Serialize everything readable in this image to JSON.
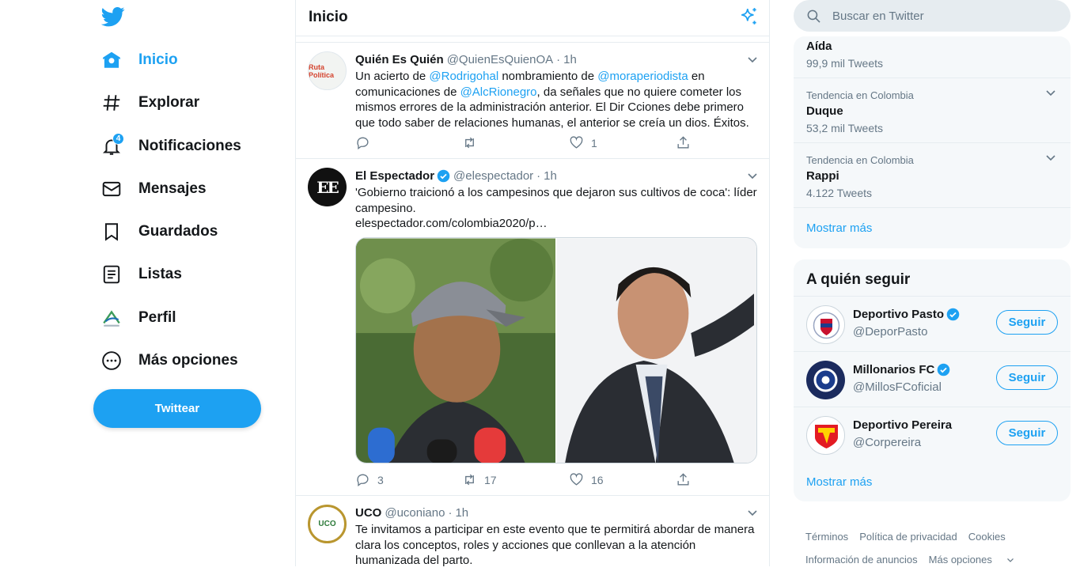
{
  "nav": {
    "items": [
      {
        "label": "Inicio",
        "icon": "home-icon"
      },
      {
        "label": "Explorar",
        "icon": "hashtag-icon"
      },
      {
        "label": "Notificaciones",
        "icon": "bell-icon",
        "badge": "4"
      },
      {
        "label": "Mensajes",
        "icon": "envelope-icon"
      },
      {
        "label": "Guardados",
        "icon": "bookmark-icon"
      },
      {
        "label": "Listas",
        "icon": "list-icon"
      },
      {
        "label": "Perfil",
        "icon": "profile-avatar-icon"
      },
      {
        "label": "Más opciones",
        "icon": "more-circle-icon"
      }
    ],
    "tweet_button": "Twittear"
  },
  "main": {
    "title": "Inicio",
    "tweets": [
      {
        "name": "Quién Es Quién",
        "handle": "@QuienEsQuienOA",
        "sep": "·",
        "time": "1h",
        "text_parts": {
          "p1": "Un acierto de ",
          "m1": "@Rodrigohal",
          "p2": " nombramiento de ",
          "m2": "@moraperiodista",
          "p3": " en comunicaciones de ",
          "m3": "@AlcRionegro",
          "p4": ", da señales que no quiere cometer los mismos errores de la administración anterior. El Dir Cciones debe primero que todo saber de relaciones humanas, el anterior se creía un dios. Éxitos."
        },
        "replies": "",
        "retweets": "",
        "likes": "1",
        "avatar_text": "Ruta Política"
      },
      {
        "name": "El Espectador",
        "handle": "@elespectador",
        "sep": "·",
        "time": "1h",
        "text": "'Gobierno traicionó a los campesinos que dejaron sus cultivos de coca': líder campesino.",
        "link": "elespectador.com/colombia2020/p…",
        "replies": "3",
        "retweets": "17",
        "likes": "16",
        "avatar_text": "EE"
      },
      {
        "name": "UCO",
        "handle": "@uconiano",
        "sep": "·",
        "time": "1h",
        "text": "Te invitamos a participar en este evento que te permitirá abordar de manera clara los conceptos, roles y acciones que conllevan a la atención humanizada del parto.",
        "avatar_text": "UCO"
      }
    ]
  },
  "search": {
    "placeholder": "Buscar en Twitter"
  },
  "trends": {
    "items": [
      {
        "context": "",
        "name": "Aída",
        "count": "99,9 mil Tweets"
      },
      {
        "context": "Tendencia en Colombia",
        "name": "Duque",
        "count": "53,2 mil Tweets"
      },
      {
        "context": "Tendencia en Colombia",
        "name": "Rappi",
        "count": "4.122 Tweets"
      }
    ],
    "show_more": "Mostrar más"
  },
  "who_to_follow": {
    "title": "A quién seguir",
    "accounts": [
      {
        "name": "Deportivo Pasto",
        "handle": "@DeporPasto",
        "button": "Seguir"
      },
      {
        "name": "Millonarios FC",
        "handle": "@MillosFCoficial",
        "button": "Seguir"
      },
      {
        "name": "Deportivo Pereira",
        "handle": "@Corpereira",
        "button": "Seguir"
      }
    ],
    "show_more": "Mostrar más"
  },
  "footer": {
    "links": [
      "Términos",
      "Política de privacidad",
      "Cookies",
      "Información de anuncios",
      "Más opciones"
    ]
  },
  "colors": {
    "accent": "#1da1f2",
    "text": "#14171a",
    "muted": "#657786",
    "panel": "#f5f8fa"
  }
}
